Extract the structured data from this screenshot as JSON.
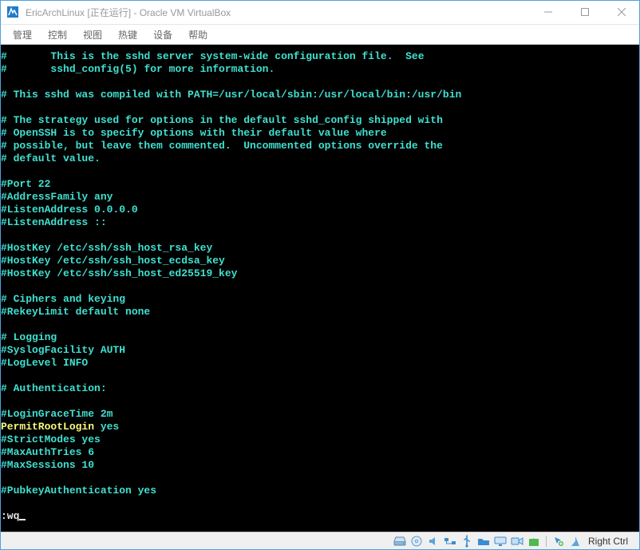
{
  "window": {
    "title": "EricArchLinux [正在运行] - Oracle VM VirtualBox"
  },
  "menu": {
    "items": [
      "管理",
      "控制",
      "视图",
      "热键",
      "设备",
      "帮助"
    ]
  },
  "terminal": {
    "lines": [
      [
        {
          "c": "cy",
          "t": "#"
        },
        {
          "c": "cy",
          "t": "\tThis is the sshd server system-wide configuration file.  See"
        }
      ],
      [
        {
          "c": "cy",
          "t": "#"
        },
        {
          "c": "cy",
          "t": "\tsshd_config(5) for more information."
        }
      ],
      [],
      [
        {
          "c": "cy",
          "t": "# This sshd was compiled with PATH=/usr/local/sbin:/usr/local/bin:/usr/bin"
        }
      ],
      [],
      [
        {
          "c": "cy",
          "t": "# The strategy used for options in the default sshd_config shipped with"
        }
      ],
      [
        {
          "c": "cy",
          "t": "# OpenSSH is to specify options with their default value where"
        }
      ],
      [
        {
          "c": "cy",
          "t": "# possible, but leave them commented.  Uncommented options override the"
        }
      ],
      [
        {
          "c": "cy",
          "t": "# default value."
        }
      ],
      [],
      [
        {
          "c": "cy",
          "t": "#Port 22"
        }
      ],
      [
        {
          "c": "cy",
          "t": "#AddressFamily any"
        }
      ],
      [
        {
          "c": "cy",
          "t": "#ListenAddress 0.0.0.0"
        }
      ],
      [
        {
          "c": "cy",
          "t": "#ListenAddress ::"
        }
      ],
      [],
      [
        {
          "c": "cy",
          "t": "#HostKey /etc/ssh/ssh_host_rsa_key"
        }
      ],
      [
        {
          "c": "cy",
          "t": "#HostKey /etc/ssh/ssh_host_ecdsa_key"
        }
      ],
      [
        {
          "c": "cy",
          "t": "#HostKey /etc/ssh/ssh_host_ed25519_key"
        }
      ],
      [],
      [
        {
          "c": "cy",
          "t": "# Ciphers and keying"
        }
      ],
      [
        {
          "c": "cy",
          "t": "#RekeyLimit default none"
        }
      ],
      [],
      [
        {
          "c": "cy",
          "t": "# Logging"
        }
      ],
      [
        {
          "c": "cy",
          "t": "#SyslogFacility AUTH"
        }
      ],
      [
        {
          "c": "cy",
          "t": "#LogLevel INFO"
        }
      ],
      [],
      [
        {
          "c": "cy",
          "t": "# Authentication:"
        }
      ],
      [],
      [
        {
          "c": "cy",
          "t": "#LoginGraceTime 2m"
        }
      ],
      [
        {
          "c": "ye",
          "t": "PermitRootLogin"
        },
        {
          "c": "cy",
          "t": " yes"
        }
      ],
      [
        {
          "c": "cy",
          "t": "#StrictModes yes"
        }
      ],
      [
        {
          "c": "cy",
          "t": "#MaxAuthTries 6"
        }
      ],
      [
        {
          "c": "cy",
          "t": "#MaxSessions 10"
        }
      ],
      [],
      [
        {
          "c": "cy",
          "t": "#PubkeyAuthentication yes"
        }
      ],
      [],
      [
        {
          "c": "wh",
          "t": ":wq"
        },
        {
          "cursor": true
        }
      ]
    ]
  },
  "statusbar": {
    "host_key": "Right Ctrl"
  }
}
